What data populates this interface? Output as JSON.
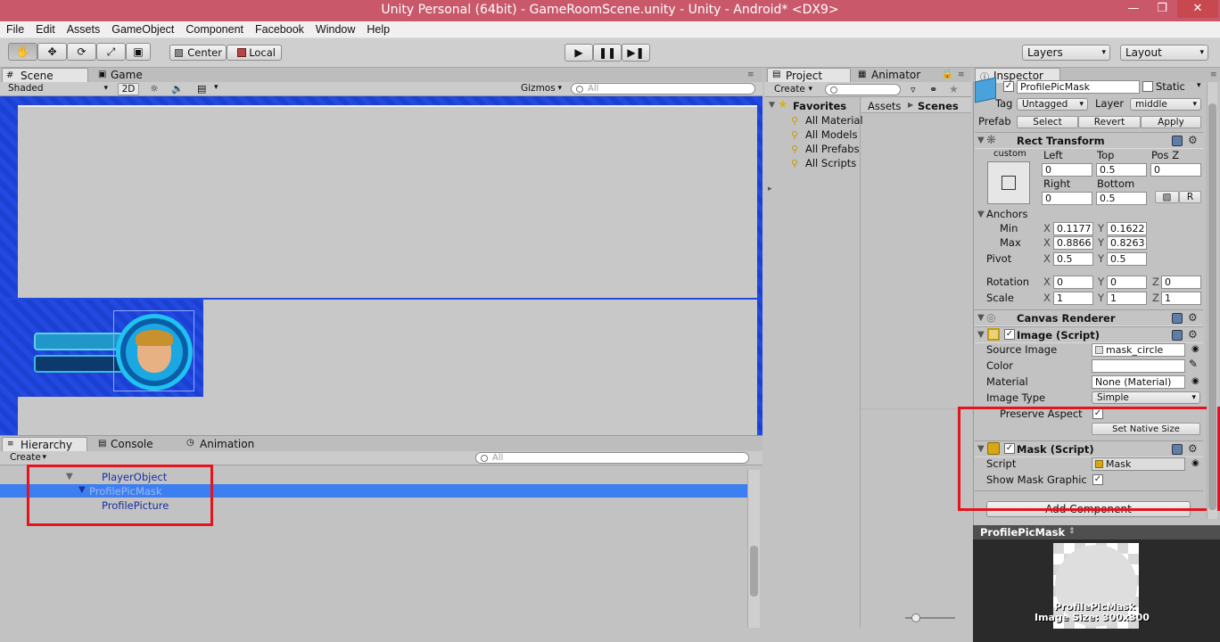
{
  "window": {
    "title": "Unity Personal (64bit) - GameRoomScene.unity - Unity - Android* <DX9>"
  },
  "menu": [
    "File",
    "Edit",
    "Assets",
    "GameObject",
    "Component",
    "Facebook",
    "Window",
    "Help"
  ],
  "toolbar": {
    "pivot_label": "Center",
    "space_label": "Local",
    "layers_label": "Layers",
    "layout_label": "Layout"
  },
  "scene_panel": {
    "tabs": [
      {
        "label": "Scene"
      },
      {
        "label": "Game"
      }
    ],
    "shading": "Shaded",
    "mode_2d": "2D",
    "gizmos": "Gizmos",
    "search_placeholder": "All",
    "colors": {
      "canvas": "#1d43d8",
      "view": "#c8c8c8"
    }
  },
  "hierarchy": {
    "tabs": [
      {
        "label": "Hierarchy"
      },
      {
        "label": "Console"
      },
      {
        "label": "Animation"
      }
    ],
    "create": "Create",
    "search_placeholder": "All",
    "items": [
      {
        "label": "PlayerObject",
        "expanded": true
      },
      {
        "label": "ProfilePicMask",
        "expanded": true,
        "selected": true
      },
      {
        "label": "ProfilePicture"
      }
    ]
  },
  "project": {
    "tabs": [
      {
        "label": "Project"
      },
      {
        "label": "Animator"
      }
    ],
    "create": "Create",
    "favorites_title": "Favorites",
    "favorites": [
      "All Material",
      "All Models",
      "All Prefabs",
      "All Scripts"
    ],
    "breadcrumb": [
      "Assets",
      "Scenes"
    ]
  },
  "inspector": {
    "tab": "Inspector",
    "object_name": "ProfilePicMask",
    "static_label": "Static",
    "tag_label": "Tag",
    "tag_value": "Untagged",
    "layer_label": "Layer",
    "layer_value": "middle",
    "prefab_label": "Prefab",
    "prefab_buttons": [
      "Select",
      "Revert",
      "Apply"
    ],
    "rect_transform": {
      "title": "Rect Transform",
      "preset": "custom",
      "left_label": "Left",
      "left": "0",
      "top_label": "Top",
      "top": "0.5",
      "posz_label": "Pos Z",
      "posz": "0",
      "right_label": "Right",
      "right": "0",
      "bottom_label": "Bottom",
      "bottom": "0.5",
      "r_button": "R",
      "anchors_label": "Anchors",
      "min_label": "Min",
      "min_x": "0.1177",
      "min_y": "0.1622",
      "max_label": "Max",
      "max_x": "0.8866",
      "max_y": "0.8263",
      "pivot_label": "Pivot",
      "pivot_x": "0.5",
      "pivot_y": "0.5",
      "rotation_label": "Rotation",
      "rot_x": "0",
      "rot_y": "0",
      "rot_z": "0",
      "scale_label": "Scale",
      "scale_x": "1",
      "scale_y": "1",
      "scale_z": "1",
      "x": "X",
      "y": "Y",
      "z": "Z"
    },
    "canvas_renderer": {
      "title": "Canvas Renderer"
    },
    "image_script": {
      "title": "Image (Script)",
      "source_label": "Source Image",
      "source_value": "mask_circle",
      "color_label": "Color",
      "material_label": "Material",
      "material_value": "None (Material)",
      "type_label": "Image Type",
      "type_value": "Simple",
      "preserve_label": "Preserve Aspect",
      "native_button": "Set Native Size"
    },
    "mask_script": {
      "title": "Mask (Script)",
      "script_label": "Script",
      "script_value": "Mask",
      "show_label": "Show Mask Graphic"
    },
    "add_component": "Add Component",
    "preview": {
      "title": "ProfilePicMask",
      "name": "ProfilePicMask",
      "size": "Image Size: 300x300"
    }
  },
  "colors": {
    "title_bar": "#c9596a",
    "selection": "#3d7ff0",
    "annotation": "#e3141e"
  }
}
